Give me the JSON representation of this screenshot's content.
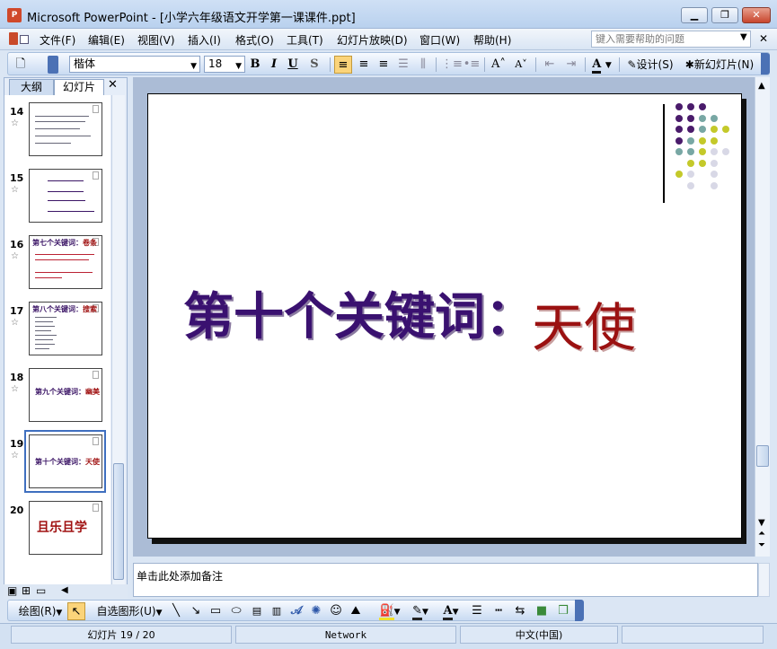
{
  "window": {
    "title": "Microsoft PowerPoint - [小学六年级语文开学第一课课件.ppt]",
    "app_icon_label": "P"
  },
  "menu": {
    "items": [
      "文件(F)",
      "编辑(E)",
      "视图(V)",
      "插入(I)",
      "格式(O)",
      "工具(T)",
      "幻灯片放映(D)",
      "窗口(W)",
      "帮助(H)"
    ],
    "help_placeholder": "键入需要帮助的问题"
  },
  "format_toolbar": {
    "font": "楷体",
    "size": "18",
    "bold": "B",
    "italic": "I",
    "underline": "U",
    "shadow": "S",
    "font_color_letter": "A",
    "design_label": "设计(S)",
    "new_slide_label": "新幻灯片(N)"
  },
  "left_pane": {
    "tabs": [
      "大纲",
      "幻灯片"
    ],
    "active_tab": "幻灯片",
    "slides": [
      {
        "num": "14",
        "kind": "text"
      },
      {
        "num": "15",
        "kind": "list"
      },
      {
        "num": "16",
        "title": "第七个关键词：",
        "title_red": "卷条",
        "kind": "title-text"
      },
      {
        "num": "17",
        "title": "第八个关键词：",
        "title_red": "搜索",
        "kind": "title-list"
      },
      {
        "num": "18",
        "title": "第九个关键词：",
        "title_red": "幽美",
        "kind": "title"
      },
      {
        "num": "19",
        "title": "第十个关键词：",
        "title_red": "天使",
        "kind": "title",
        "selected": true
      },
      {
        "num": "20",
        "title_red": "且乐且学",
        "kind": "big"
      }
    ]
  },
  "slide": {
    "title": "第十个关键词：",
    "title_word": "天使",
    "colors": {
      "title": "#3a1170",
      "word": "#9b1111"
    }
  },
  "notes": {
    "placeholder": "单击此处添加备注"
  },
  "draw_toolbar": {
    "draw_label": "绘图(R)",
    "autoshape_label": "自选图形(U)"
  },
  "status": {
    "slide_info": "幻灯片 19 / 20",
    "template": "Network",
    "language": "中文(中国)"
  }
}
